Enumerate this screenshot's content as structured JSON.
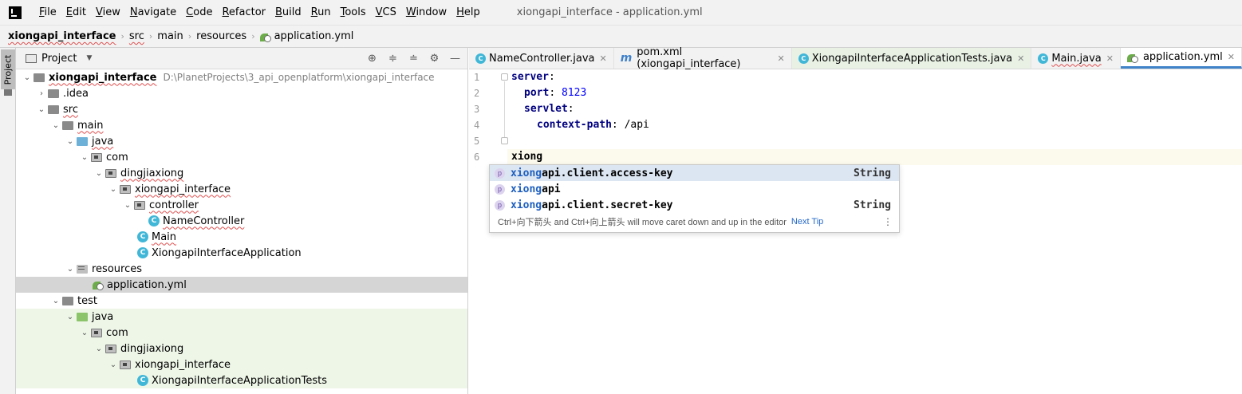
{
  "menu": {
    "items": [
      "File",
      "Edit",
      "View",
      "Navigate",
      "Code",
      "Refactor",
      "Build",
      "Run",
      "Tools",
      "VCS",
      "Window",
      "Help"
    ],
    "window_title": "xiongapi_interface - application.yml"
  },
  "breadcrumb": [
    "xiongapi_interface",
    "src",
    "main",
    "resources",
    "application.yml"
  ],
  "side_strip": {
    "project_tab": "Project"
  },
  "project_panel": {
    "title": "Project",
    "tree": [
      {
        "label": "xiongapi_interface",
        "hint": "D:\\PlanetProjects\\3_api_openplatform\\xiongapi_interface"
      },
      {
        "label": ".idea"
      },
      {
        "label": "src"
      },
      {
        "label": "main"
      },
      {
        "label": "java"
      },
      {
        "label": "com"
      },
      {
        "label": "dingjiaxiong"
      },
      {
        "label": "xiongapi_interface"
      },
      {
        "label": "controller"
      },
      {
        "label": "NameController"
      },
      {
        "label": "Main"
      },
      {
        "label": "XiongapiInterfaceApplication"
      },
      {
        "label": "resources"
      },
      {
        "label": "application.yml"
      },
      {
        "label": "test"
      },
      {
        "label": "java"
      },
      {
        "label": "com"
      },
      {
        "label": "dingjiaxiong"
      },
      {
        "label": "xiongapi_interface"
      },
      {
        "label": "XiongapiInterfaceApplicationTests"
      }
    ]
  },
  "editor": {
    "tabs": [
      {
        "label": "NameController.java"
      },
      {
        "label": "pom.xml (xiongapi_interface)"
      },
      {
        "label": "XiongapiInterfaceApplicationTests.java"
      },
      {
        "label": "Main.java"
      },
      {
        "label": "application.yml"
      }
    ],
    "line_numbers": [
      "1",
      "2",
      "3",
      "4",
      "5",
      "6"
    ],
    "lines": [
      {
        "key": "server",
        "sep": ":",
        "value": ""
      },
      {
        "key": "port",
        "sep": ": ",
        "value": "8123"
      },
      {
        "key": "servlet",
        "sep": ":",
        "value": ""
      },
      {
        "key": "context-path",
        "sep": ": ",
        "value": "/api"
      },
      {
        "key": "",
        "sep": "",
        "value": ""
      },
      {
        "key": "",
        "sep": "",
        "value": "xiong"
      }
    ]
  },
  "completion": {
    "items": [
      {
        "icon": "p",
        "match": "xiong",
        "rest": "api.client.access-key",
        "type": "String"
      },
      {
        "icon": "p",
        "match": "xiong",
        "rest": "api",
        "type": ""
      },
      {
        "icon": "p",
        "match": "xiong",
        "rest": "api.client.secret-key",
        "type": "String"
      }
    ],
    "hint": "Ctrl+向下箭头 and Ctrl+向上箭头 will move caret down and up in the editor",
    "next_tip": "Next Tip"
  }
}
